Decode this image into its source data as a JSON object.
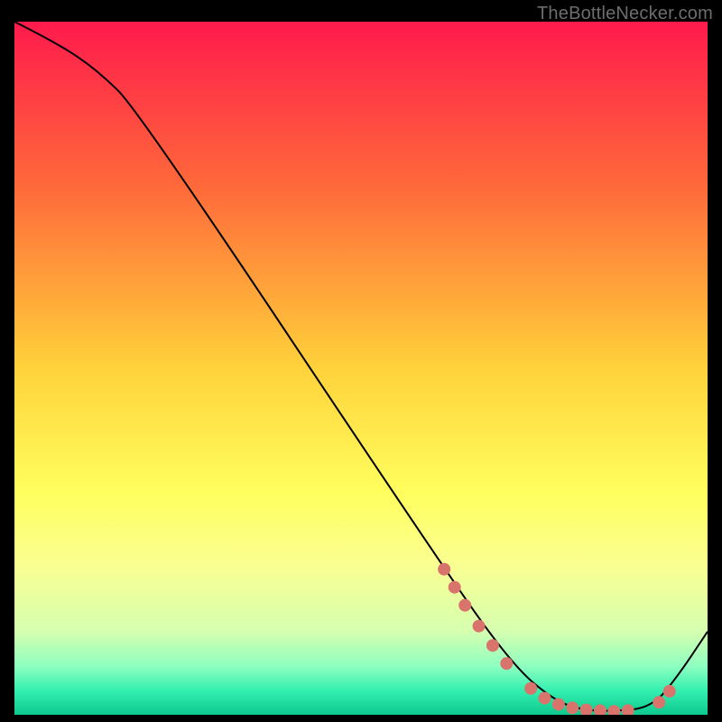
{
  "watermark": "TheBottleNecker.com",
  "chart_data": {
    "type": "line",
    "title": "",
    "xlabel": "",
    "ylabel": "",
    "xlim": [
      0,
      100
    ],
    "ylim": [
      0,
      100
    ],
    "background": {
      "type": "vertical-gradient",
      "stops": [
        {
          "offset": 0.0,
          "color": "#ff1a4c"
        },
        {
          "offset": 0.24,
          "color": "#ff6a3a"
        },
        {
          "offset": 0.5,
          "color": "#ffd23a"
        },
        {
          "offset": 0.68,
          "color": "#ffff5e"
        },
        {
          "offset": 0.78,
          "color": "#faff90"
        },
        {
          "offset": 0.88,
          "color": "#d6ffb0"
        },
        {
          "offset": 0.93,
          "color": "#8dffc0"
        },
        {
          "offset": 0.965,
          "color": "#33efb0"
        },
        {
          "offset": 1.0,
          "color": "#0dc98d"
        }
      ]
    },
    "series": [
      {
        "name": "curve",
        "stroke": "#000000",
        "stroke_width": 2,
        "x": [
          0,
          6,
          12,
          18,
          62,
          72,
          78,
          82,
          86,
          92,
          96,
          100
        ],
        "y": [
          100,
          97,
          93,
          87,
          21,
          7,
          2,
          0.7,
          0.5,
          1,
          6,
          12
        ]
      }
    ],
    "markers": {
      "color": "#d9746c",
      "radius": 7,
      "points": [
        {
          "x": 62.0,
          "y": 21.0
        },
        {
          "x": 63.5,
          "y": 18.4
        },
        {
          "x": 65.0,
          "y": 15.8
        },
        {
          "x": 67.0,
          "y": 12.8
        },
        {
          "x": 69.0,
          "y": 10.0
        },
        {
          "x": 71.0,
          "y": 7.4
        },
        {
          "x": 74.5,
          "y": 3.8
        },
        {
          "x": 76.5,
          "y": 2.4
        },
        {
          "x": 78.5,
          "y": 1.5
        },
        {
          "x": 80.5,
          "y": 1.0
        },
        {
          "x": 82.5,
          "y": 0.7
        },
        {
          "x": 84.5,
          "y": 0.6
        },
        {
          "x": 86.5,
          "y": 0.5
        },
        {
          "x": 88.5,
          "y": 0.6
        },
        {
          "x": 93.0,
          "y": 1.8
        },
        {
          "x": 94.5,
          "y": 3.4
        }
      ]
    }
  }
}
